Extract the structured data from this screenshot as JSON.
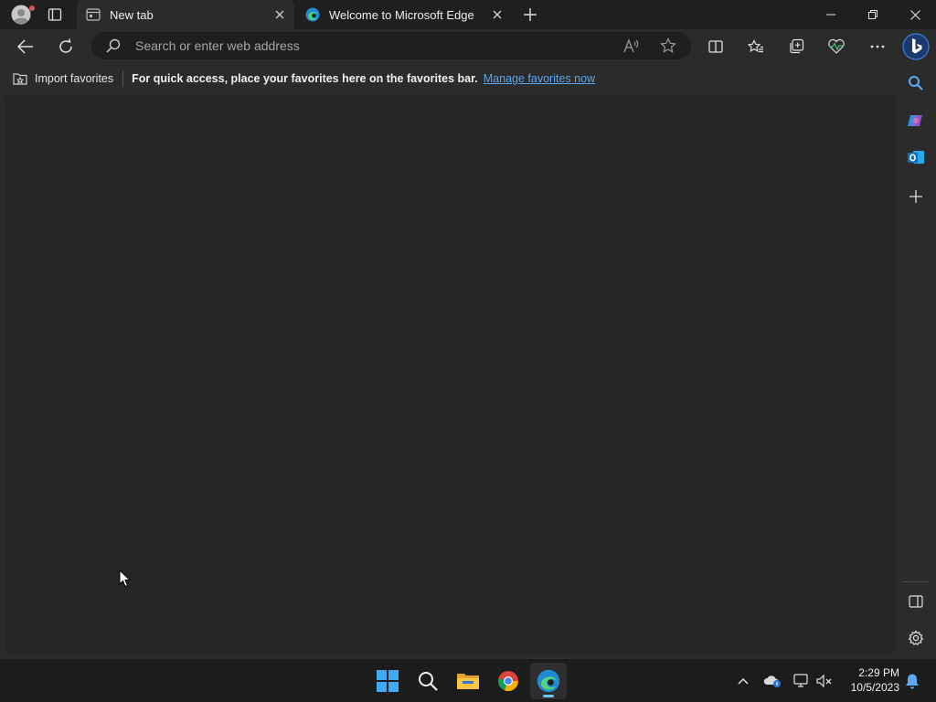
{
  "browser": {
    "tabs": [
      {
        "title": "New tab",
        "active": true
      },
      {
        "title": "Welcome to Microsoft Edge",
        "active": false
      }
    ],
    "address_bar": {
      "placeholder": "Search or enter web address",
      "value": ""
    },
    "favorites_bar": {
      "import_label": "Import favorites",
      "message": "For quick access, place your favorites here on the favorites bar.",
      "manage_link": "Manage favorites now"
    },
    "toolbar_icons": [
      "back-icon",
      "refresh-icon",
      "read-aloud-icon",
      "add-favorite-icon",
      "split-screen-icon",
      "favorites-icon",
      "collections-icon",
      "browser-essentials-icon",
      "more-icon",
      "bing-copilot-icon"
    ],
    "sidebar_icons": [
      "search-icon",
      "copilot-icon",
      "outlook-icon",
      "add-icon",
      "hide-sidebar-icon",
      "settings-icon"
    ]
  },
  "taskbar": {
    "apps": [
      "windows-start-icon",
      "search-icon",
      "file-explorer-icon",
      "chrome-icon",
      "edge-icon"
    ],
    "tray_icons": [
      "chevron-up-icon",
      "onedrive-icon",
      "network-icon",
      "volume-muted-icon",
      "notification-bell-icon"
    ],
    "clock": {
      "time": "2:29 PM",
      "date": "10/5/2023"
    }
  },
  "colors": {
    "accent": "#5aa7f0",
    "chrome_dark": "#1f1f1f",
    "toolbar": "#2b2b2b",
    "content": "#262626"
  }
}
